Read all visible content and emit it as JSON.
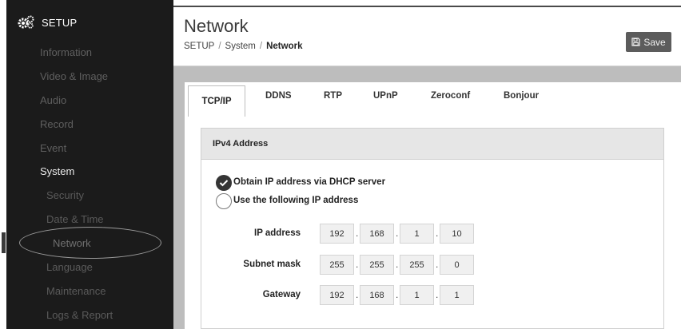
{
  "sidebar": {
    "header": "SETUP",
    "items": [
      {
        "label": "Information"
      },
      {
        "label": "Video & Image"
      },
      {
        "label": "Audio"
      },
      {
        "label": "Record"
      },
      {
        "label": "Event"
      },
      {
        "label": "System"
      },
      {
        "label": "Security"
      },
      {
        "label": "Date & Time"
      },
      {
        "label": "Network"
      },
      {
        "label": "Language"
      },
      {
        "label": "Maintenance"
      },
      {
        "label": "Logs & Report"
      }
    ]
  },
  "header": {
    "title": "Network",
    "breadcrumb": [
      "SETUP",
      "System",
      "Network"
    ],
    "save_label": "Save",
    "save_icon": "floppy-disk-icon"
  },
  "tabs": [
    "TCP/IP",
    "DDNS",
    "RTP",
    "UPnP",
    "Zeroconf",
    "Bonjour"
  ],
  "active_tab": "TCP/IP",
  "ipv4": {
    "section_title": "IPv4 Address",
    "options": [
      {
        "label": "Obtain IP address via DHCP server",
        "selected": true
      },
      {
        "label": "Use the following IP address",
        "selected": false
      }
    ],
    "fields": [
      {
        "label": "IP address",
        "octets": [
          "192",
          "168",
          "1",
          "10"
        ]
      },
      {
        "label": "Subnet mask",
        "octets": [
          "255",
          "255",
          "255",
          "0"
        ]
      },
      {
        "label": "Gateway",
        "octets": [
          "192",
          "168",
          "1",
          "1"
        ]
      }
    ]
  },
  "colors": {
    "sidebar_bg": "#1b1b1b",
    "content_bg": "#bdbdbd",
    "button_bg": "#5c5c5c"
  }
}
